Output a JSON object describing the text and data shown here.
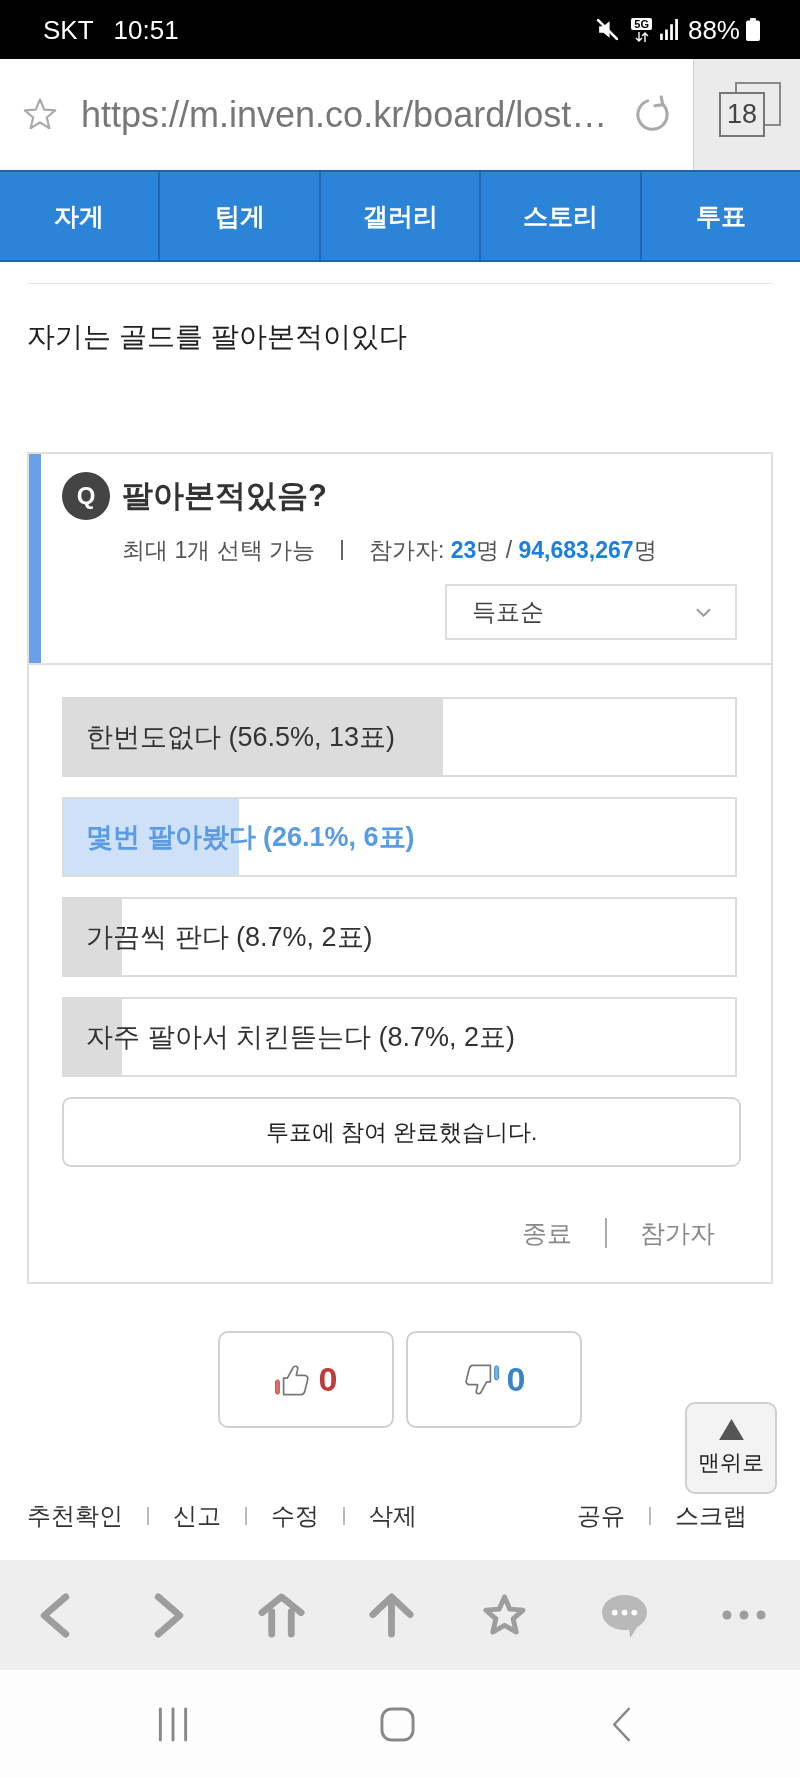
{
  "status_bar": {
    "carrier": "SKT",
    "time": "10:51",
    "network": "5G",
    "battery": "88%"
  },
  "address_bar": {
    "url": "https://m.inven.co.kr/board/lost…",
    "tab_count": "18"
  },
  "board_tabs": [
    {
      "label": "자게"
    },
    {
      "label": "팁게"
    },
    {
      "label": "갤러리"
    },
    {
      "label": "스토리"
    },
    {
      "label": "투표"
    }
  ],
  "post": {
    "body": "자기는 골드를 팔아본적이있다"
  },
  "poll": {
    "badge": "Q",
    "question": "팔아본적있음?",
    "limit": "최대 1개 선택 가능",
    "participants": "참가자: **23**명 / **94,683,267**명",
    "sort": "득표순",
    "options": [
      {
        "label": "한번도없다 (56.5%, 13표)",
        "level": 0.565,
        "selected": false
      },
      {
        "label": "몇번 팔아봤다 (26.1%, 6표)",
        "level": 0.261,
        "selected": true
      },
      {
        "label": "가끔씩 판다 (8.7%, 2표)",
        "level": 0.087,
        "selected": false
      },
      {
        "label": "자주 팔아서 치킨뜯는다 (8.7%, 2표)",
        "level": 0.087,
        "selected": false
      }
    ],
    "status_button": "투표에 참여 완료했습니다.",
    "footer_links": [
      "종료",
      "참가자"
    ]
  },
  "reactions": [
    {
      "kind": "like",
      "count": "0"
    },
    {
      "kind": "dislike",
      "count": "0"
    }
  ],
  "scroll_top": "맨위로",
  "post_actions": {
    "left": [
      "추천확인",
      "신고",
      "수정",
      "삭제"
    ],
    "right": [
      "공유",
      "스크랩"
    ]
  }
}
